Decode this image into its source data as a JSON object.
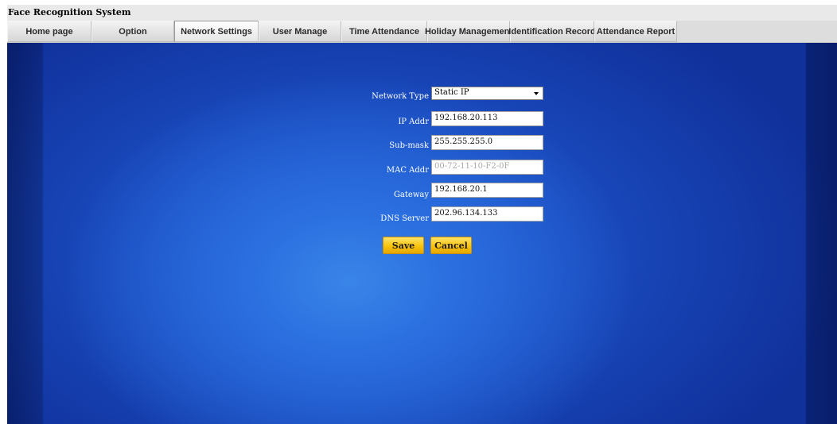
{
  "app": {
    "title": "Face Recognition System"
  },
  "tabs": [
    {
      "label": "Home page"
    },
    {
      "label": "Option"
    },
    {
      "label": "Network Settings",
      "active": true
    },
    {
      "label": "User Manage"
    },
    {
      "label": "Time Attendance"
    },
    {
      "label": "Holiday Management"
    },
    {
      "label": "Identification Record"
    },
    {
      "label": "Attendance Report"
    }
  ],
  "form": {
    "network_type": {
      "label": "Network Type",
      "value": "Static IP"
    },
    "ip_addr": {
      "label": "IP Addr",
      "value": "192.168.20.113"
    },
    "sub_mask": {
      "label": "Sub-mask",
      "value": "255.255.255.0"
    },
    "mac_addr": {
      "label": "MAC Addr",
      "value": "00-72-11-10-F2-0F"
    },
    "gateway": {
      "label": "Gateway",
      "value": "192.168.20.1"
    },
    "dns_server": {
      "label": "DNS Server",
      "value": "202.96.134.133"
    }
  },
  "buttons": {
    "save": "Save",
    "cancel": "Cancel"
  },
  "colors": {
    "accent_button": "#f8c30c",
    "background_blue": "#1f5bd4"
  }
}
